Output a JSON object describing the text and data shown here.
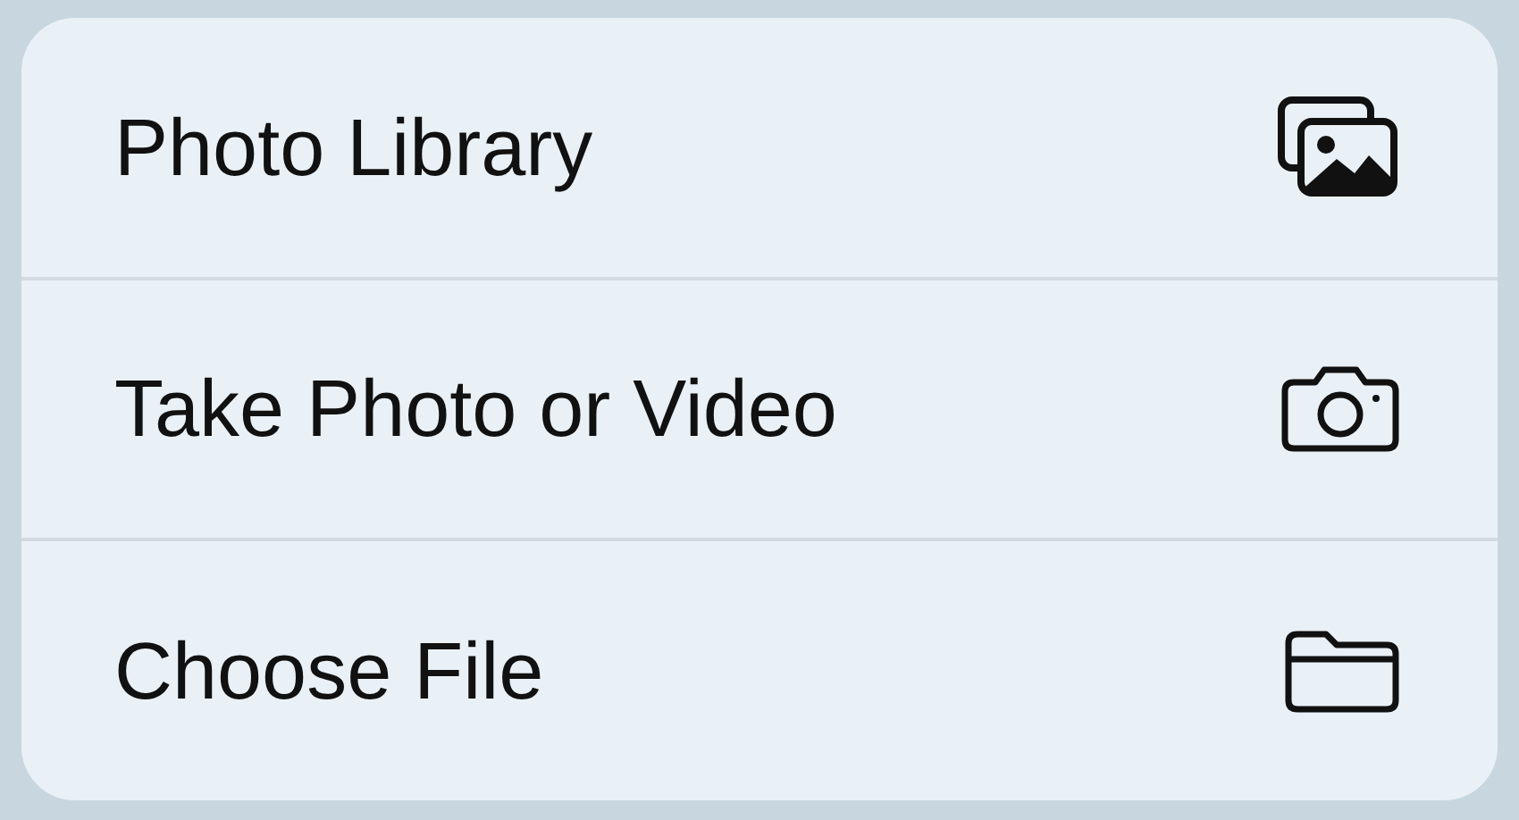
{
  "menu": {
    "items": [
      {
        "label": "Photo Library"
      },
      {
        "label": "Take Photo or Video"
      },
      {
        "label": "Choose File"
      }
    ]
  }
}
